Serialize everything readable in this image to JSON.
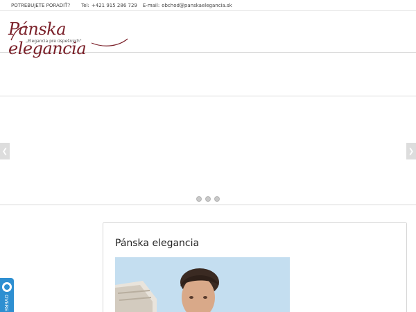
{
  "topbar": {
    "help_text": "POTREBUJETE PORADIŤ?",
    "tel_label": "Tel:",
    "tel_value": "+421 915 286 729",
    "email_label": "E-mail:",
    "email_value": "obchod@panskaelegancia.sk"
  },
  "logo": {
    "brand": "Pánska elegancia",
    "tagline": "„Elegancia pre úspešných\""
  },
  "slider": {
    "prev_icon": "chevron-left-icon",
    "next_icon": "chevron-right-icon",
    "slide_count": 3
  },
  "content": {
    "title": "Pánska elegancia"
  },
  "side_tab": {
    "label": "OVERE"
  },
  "colors": {
    "brand": "#7a1f28",
    "side_tab": "#2e8fd1"
  }
}
